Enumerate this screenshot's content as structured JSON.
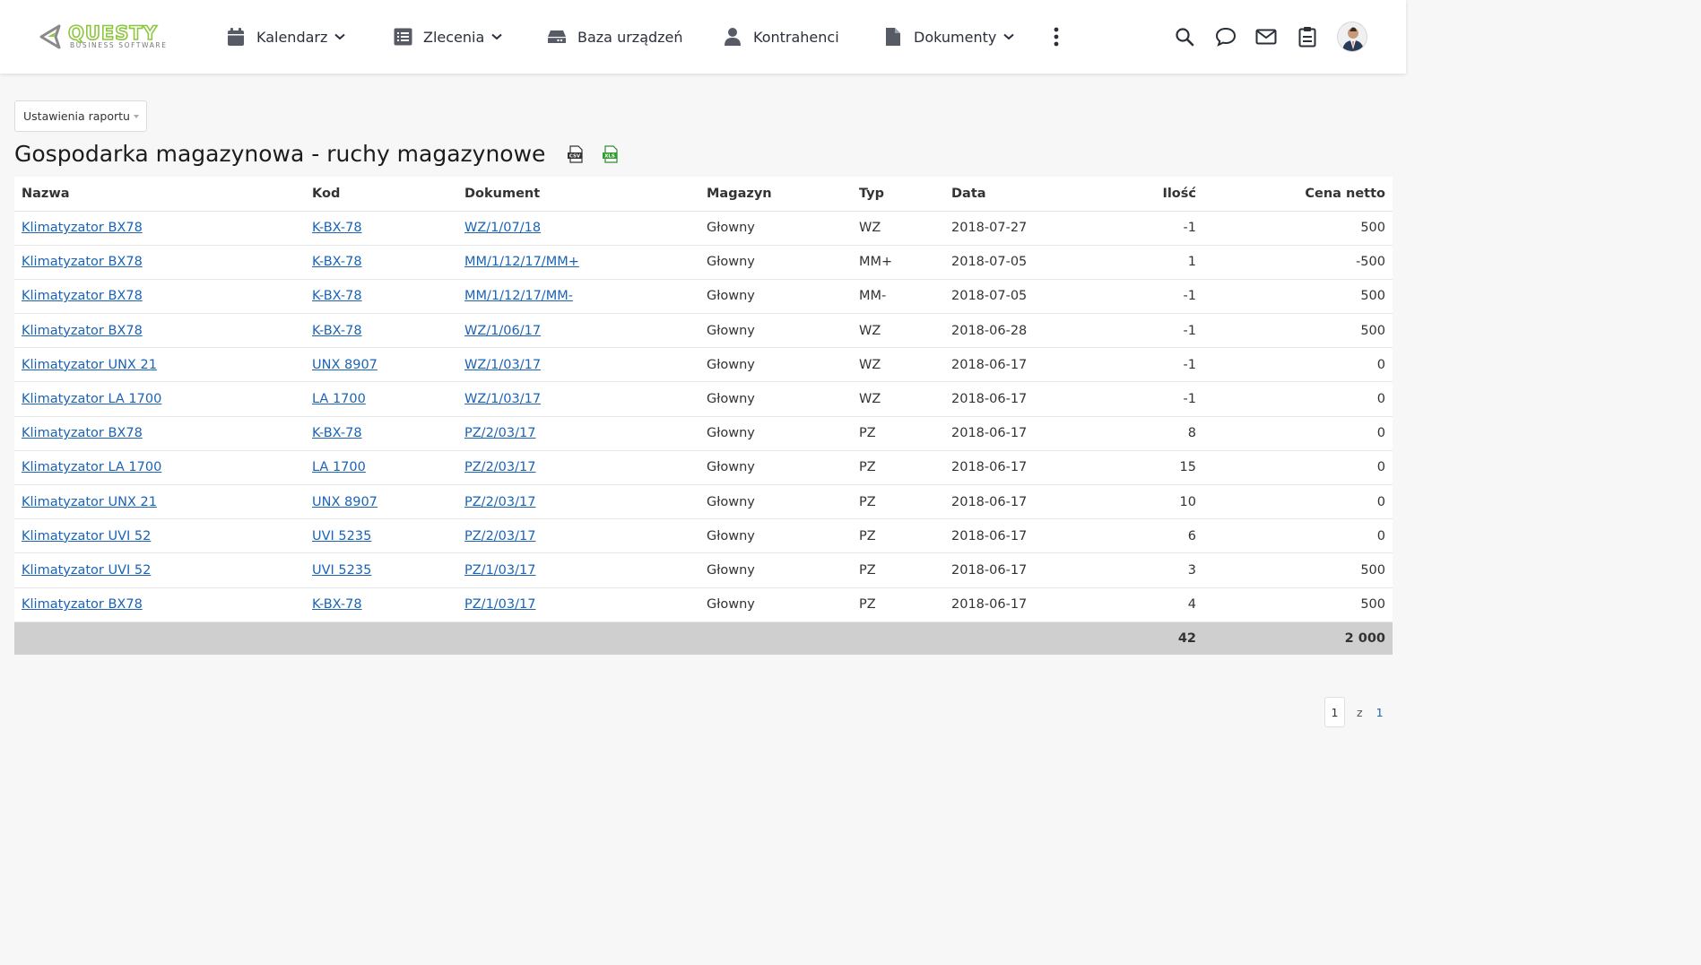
{
  "brand": {
    "name": "QUESTY",
    "tagline": "BUSINESS SOFTWARE",
    "accent": "#8cc63f"
  },
  "nav": {
    "calendar": "Kalendarz",
    "orders": "Zlecenia",
    "devices": "Baza urządzeń",
    "contractors": "Kontrahenci",
    "documents": "Dokumenty"
  },
  "settings_button": "Ustawienia raportu",
  "title": "Gospodarka magazynowa - ruchy magazynowe",
  "exports": {
    "csv": "CSV",
    "xls": "XLS"
  },
  "columns": [
    "Nazwa",
    "Kod",
    "Dokument",
    "Magazyn",
    "Typ",
    "Data",
    "Ilość",
    "Cena netto"
  ],
  "rows": [
    {
      "name": "Klimatyzator BX78",
      "code": "K-BX-78",
      "doc": "WZ/1/07/18",
      "warehouse": "Głowny",
      "type": "WZ",
      "date": "2018-07-27",
      "qty": "-1",
      "price": "500"
    },
    {
      "name": "Klimatyzator BX78",
      "code": "K-BX-78",
      "doc": "MM/1/12/17/MM+",
      "warehouse": "Głowny",
      "type": "MM+",
      "date": "2018-07-05",
      "qty": "1",
      "price": "-500"
    },
    {
      "name": "Klimatyzator BX78",
      "code": "K-BX-78",
      "doc": "MM/1/12/17/MM-",
      "warehouse": "Głowny",
      "type": "MM-",
      "date": "2018-07-05",
      "qty": "-1",
      "price": "500"
    },
    {
      "name": "Klimatyzator BX78",
      "code": "K-BX-78",
      "doc": "WZ/1/06/17",
      "warehouse": "Głowny",
      "type": "WZ",
      "date": "2018-06-28",
      "qty": "-1",
      "price": "500"
    },
    {
      "name": "Klimatyzator UNX 21",
      "code": "UNX 8907",
      "doc": "WZ/1/03/17",
      "warehouse": "Głowny",
      "type": "WZ",
      "date": "2018-06-17",
      "qty": "-1",
      "price": "0"
    },
    {
      "name": "Klimatyzator LA 1700",
      "code": "LA 1700",
      "doc": "WZ/1/03/17",
      "warehouse": "Głowny",
      "type": "WZ",
      "date": "2018-06-17",
      "qty": "-1",
      "price": "0"
    },
    {
      "name": "Klimatyzator BX78",
      "code": "K-BX-78",
      "doc": "PZ/2/03/17",
      "warehouse": "Głowny",
      "type": "PZ",
      "date": "2018-06-17",
      "qty": "8",
      "price": "0"
    },
    {
      "name": "Klimatyzator LA 1700",
      "code": "LA 1700",
      "doc": "PZ/2/03/17",
      "warehouse": "Głowny",
      "type": "PZ",
      "date": "2018-06-17",
      "qty": "15",
      "price": "0"
    },
    {
      "name": "Klimatyzator UNX 21",
      "code": "UNX 8907",
      "doc": "PZ/2/03/17",
      "warehouse": "Głowny",
      "type": "PZ",
      "date": "2018-06-17",
      "qty": "10",
      "price": "0"
    },
    {
      "name": "Klimatyzator UVI 52",
      "code": "UVI 5235",
      "doc": "PZ/2/03/17",
      "warehouse": "Głowny",
      "type": "PZ",
      "date": "2018-06-17",
      "qty": "6",
      "price": "0"
    },
    {
      "name": "Klimatyzator UVI 52",
      "code": "UVI 5235",
      "doc": "PZ/1/03/17",
      "warehouse": "Głowny",
      "type": "PZ",
      "date": "2018-06-17",
      "qty": "3",
      "price": "500"
    },
    {
      "name": "Klimatyzator BX78",
      "code": "K-BX-78",
      "doc": "PZ/1/03/17",
      "warehouse": "Głowny",
      "type": "PZ",
      "date": "2018-06-17",
      "qty": "4",
      "price": "500"
    }
  ],
  "totals": {
    "qty": "42",
    "price": "2 000"
  },
  "pagination": {
    "current": "1",
    "of": "z",
    "total": "1"
  },
  "icons": {
    "calendar": "calendar-icon",
    "orders": "list-icon",
    "devices": "hard-drive-icon",
    "contractors": "user-icon",
    "documents": "document-icon",
    "more": "more-vertical-icon",
    "search": "search-icon",
    "chat": "chat-icon",
    "mail": "mail-icon",
    "clipboard": "clipboard-icon"
  }
}
